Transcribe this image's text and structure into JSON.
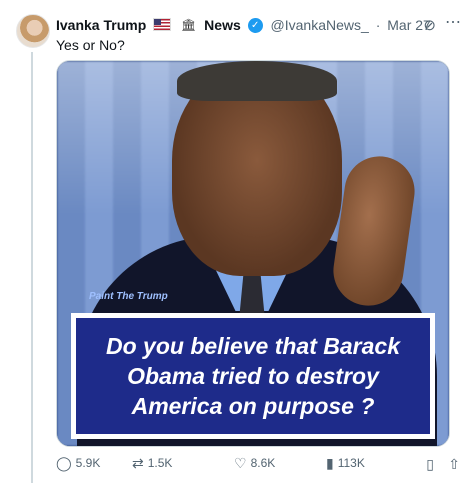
{
  "tweet": {
    "author_name": "Ivanka Trump",
    "flag_icon": "us-flag-icon",
    "news_icon": "news-icon",
    "news_label": "News",
    "handle": "@IvankaNews_",
    "dot": "·",
    "date": "Mar 27",
    "text": "Yes or No?"
  },
  "media": {
    "watermark": "Paint The Trump",
    "caption": "Do you believe that Barack Obama tried to destroy America on purpose ?",
    "caption_bg": "#1e2b8a"
  },
  "actions": {
    "replies": "5.9K",
    "reposts": "1.5K",
    "likes": "8.6K",
    "views": "113K"
  },
  "icons": {
    "more": "⋯",
    "grok": "⊘",
    "reply": "◯",
    "repost": "⇄",
    "like": "♡",
    "views": "▮",
    "bookmark": "▯",
    "share": "⇧"
  }
}
